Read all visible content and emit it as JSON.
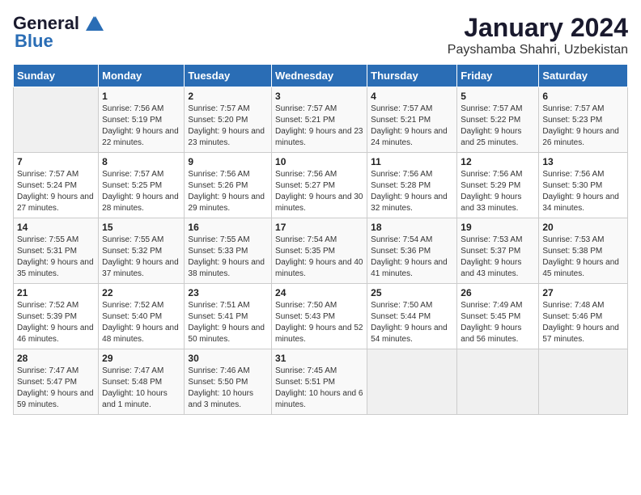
{
  "logo": {
    "general": "General",
    "blue": "Blue"
  },
  "title": "January 2024",
  "subtitle": "Payshamba Shahri, Uzbekistan",
  "headers": [
    "Sunday",
    "Monday",
    "Tuesday",
    "Wednesday",
    "Thursday",
    "Friday",
    "Saturday"
  ],
  "weeks": [
    [
      {
        "day": "",
        "sunrise": "",
        "sunset": "",
        "daylight": ""
      },
      {
        "day": "1",
        "sunrise": "Sunrise: 7:56 AM",
        "sunset": "Sunset: 5:19 PM",
        "daylight": "Daylight: 9 hours and 22 minutes."
      },
      {
        "day": "2",
        "sunrise": "Sunrise: 7:57 AM",
        "sunset": "Sunset: 5:20 PM",
        "daylight": "Daylight: 9 hours and 23 minutes."
      },
      {
        "day": "3",
        "sunrise": "Sunrise: 7:57 AM",
        "sunset": "Sunset: 5:21 PM",
        "daylight": "Daylight: 9 hours and 23 minutes."
      },
      {
        "day": "4",
        "sunrise": "Sunrise: 7:57 AM",
        "sunset": "Sunset: 5:21 PM",
        "daylight": "Daylight: 9 hours and 24 minutes."
      },
      {
        "day": "5",
        "sunrise": "Sunrise: 7:57 AM",
        "sunset": "Sunset: 5:22 PM",
        "daylight": "Daylight: 9 hours and 25 minutes."
      },
      {
        "day": "6",
        "sunrise": "Sunrise: 7:57 AM",
        "sunset": "Sunset: 5:23 PM",
        "daylight": "Daylight: 9 hours and 26 minutes."
      }
    ],
    [
      {
        "day": "7",
        "sunrise": "Sunrise: 7:57 AM",
        "sunset": "Sunset: 5:24 PM",
        "daylight": "Daylight: 9 hours and 27 minutes."
      },
      {
        "day": "8",
        "sunrise": "Sunrise: 7:57 AM",
        "sunset": "Sunset: 5:25 PM",
        "daylight": "Daylight: 9 hours and 28 minutes."
      },
      {
        "day": "9",
        "sunrise": "Sunrise: 7:56 AM",
        "sunset": "Sunset: 5:26 PM",
        "daylight": "Daylight: 9 hours and 29 minutes."
      },
      {
        "day": "10",
        "sunrise": "Sunrise: 7:56 AM",
        "sunset": "Sunset: 5:27 PM",
        "daylight": "Daylight: 9 hours and 30 minutes."
      },
      {
        "day": "11",
        "sunrise": "Sunrise: 7:56 AM",
        "sunset": "Sunset: 5:28 PM",
        "daylight": "Daylight: 9 hours and 32 minutes."
      },
      {
        "day": "12",
        "sunrise": "Sunrise: 7:56 AM",
        "sunset": "Sunset: 5:29 PM",
        "daylight": "Daylight: 9 hours and 33 minutes."
      },
      {
        "day": "13",
        "sunrise": "Sunrise: 7:56 AM",
        "sunset": "Sunset: 5:30 PM",
        "daylight": "Daylight: 9 hours and 34 minutes."
      }
    ],
    [
      {
        "day": "14",
        "sunrise": "Sunrise: 7:55 AM",
        "sunset": "Sunset: 5:31 PM",
        "daylight": "Daylight: 9 hours and 35 minutes."
      },
      {
        "day": "15",
        "sunrise": "Sunrise: 7:55 AM",
        "sunset": "Sunset: 5:32 PM",
        "daylight": "Daylight: 9 hours and 37 minutes."
      },
      {
        "day": "16",
        "sunrise": "Sunrise: 7:55 AM",
        "sunset": "Sunset: 5:33 PM",
        "daylight": "Daylight: 9 hours and 38 minutes."
      },
      {
        "day": "17",
        "sunrise": "Sunrise: 7:54 AM",
        "sunset": "Sunset: 5:35 PM",
        "daylight": "Daylight: 9 hours and 40 minutes."
      },
      {
        "day": "18",
        "sunrise": "Sunrise: 7:54 AM",
        "sunset": "Sunset: 5:36 PM",
        "daylight": "Daylight: 9 hours and 41 minutes."
      },
      {
        "day": "19",
        "sunrise": "Sunrise: 7:53 AM",
        "sunset": "Sunset: 5:37 PM",
        "daylight": "Daylight: 9 hours and 43 minutes."
      },
      {
        "day": "20",
        "sunrise": "Sunrise: 7:53 AM",
        "sunset": "Sunset: 5:38 PM",
        "daylight": "Daylight: 9 hours and 45 minutes."
      }
    ],
    [
      {
        "day": "21",
        "sunrise": "Sunrise: 7:52 AM",
        "sunset": "Sunset: 5:39 PM",
        "daylight": "Daylight: 9 hours and 46 minutes."
      },
      {
        "day": "22",
        "sunrise": "Sunrise: 7:52 AM",
        "sunset": "Sunset: 5:40 PM",
        "daylight": "Daylight: 9 hours and 48 minutes."
      },
      {
        "day": "23",
        "sunrise": "Sunrise: 7:51 AM",
        "sunset": "Sunset: 5:41 PM",
        "daylight": "Daylight: 9 hours and 50 minutes."
      },
      {
        "day": "24",
        "sunrise": "Sunrise: 7:50 AM",
        "sunset": "Sunset: 5:43 PM",
        "daylight": "Daylight: 9 hours and 52 minutes."
      },
      {
        "day": "25",
        "sunrise": "Sunrise: 7:50 AM",
        "sunset": "Sunset: 5:44 PM",
        "daylight": "Daylight: 9 hours and 54 minutes."
      },
      {
        "day": "26",
        "sunrise": "Sunrise: 7:49 AM",
        "sunset": "Sunset: 5:45 PM",
        "daylight": "Daylight: 9 hours and 56 minutes."
      },
      {
        "day": "27",
        "sunrise": "Sunrise: 7:48 AM",
        "sunset": "Sunset: 5:46 PM",
        "daylight": "Daylight: 9 hours and 57 minutes."
      }
    ],
    [
      {
        "day": "28",
        "sunrise": "Sunrise: 7:47 AM",
        "sunset": "Sunset: 5:47 PM",
        "daylight": "Daylight: 9 hours and 59 minutes."
      },
      {
        "day": "29",
        "sunrise": "Sunrise: 7:47 AM",
        "sunset": "Sunset: 5:48 PM",
        "daylight": "Daylight: 10 hours and 1 minute."
      },
      {
        "day": "30",
        "sunrise": "Sunrise: 7:46 AM",
        "sunset": "Sunset: 5:50 PM",
        "daylight": "Daylight: 10 hours and 3 minutes."
      },
      {
        "day": "31",
        "sunrise": "Sunrise: 7:45 AM",
        "sunset": "Sunset: 5:51 PM",
        "daylight": "Daylight: 10 hours and 6 minutes."
      },
      {
        "day": "",
        "sunrise": "",
        "sunset": "",
        "daylight": ""
      },
      {
        "day": "",
        "sunrise": "",
        "sunset": "",
        "daylight": ""
      },
      {
        "day": "",
        "sunrise": "",
        "sunset": "",
        "daylight": ""
      }
    ]
  ]
}
